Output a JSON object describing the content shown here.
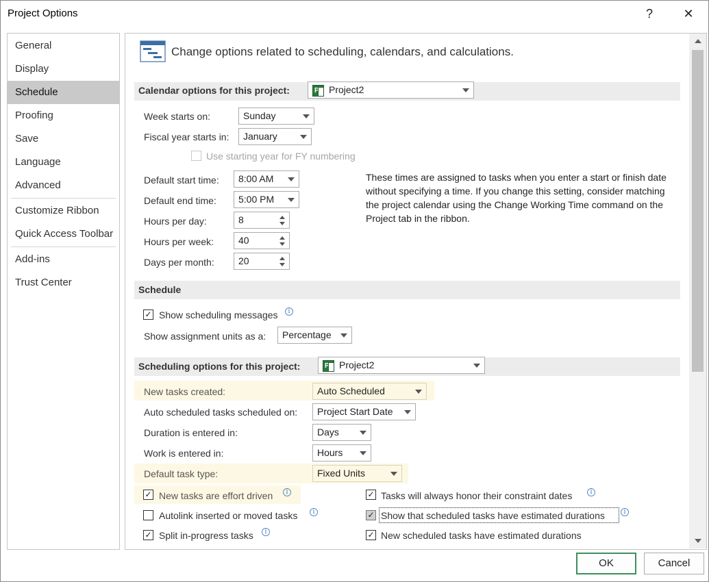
{
  "window": {
    "title": "Project Options",
    "help": "?",
    "close": "✕"
  },
  "sidebar": {
    "items": [
      {
        "label": "General"
      },
      {
        "label": "Display"
      },
      {
        "label": "Schedule"
      },
      {
        "label": "Proofing"
      },
      {
        "label": "Save"
      },
      {
        "label": "Language"
      },
      {
        "label": "Advanced"
      },
      {
        "label": "Customize Ribbon"
      },
      {
        "label": "Quick Access Toolbar"
      },
      {
        "label": "Add-ins"
      },
      {
        "label": "Trust Center"
      }
    ],
    "selected": "Schedule"
  },
  "header": {
    "text": "Change options related to scheduling, calendars, and calculations."
  },
  "calendar": {
    "section_title": "Calendar options for this project:",
    "project_value": "Project2",
    "week_starts_label": "Week starts on:",
    "week_starts_value": "Sunday",
    "fiscal_label": "Fiscal year starts in:",
    "fiscal_value": "January",
    "fy_numbering_label": "Use starting year for FY numbering",
    "start_time_label": "Default start time:",
    "start_time_value": "8:00 AM",
    "end_time_label": "Default end time:",
    "end_time_value": "5:00 PM",
    "hours_day_label": "Hours per day:",
    "hours_day_value": "8",
    "hours_week_label": "Hours per week:",
    "hours_week_value": "40",
    "days_month_label": "Days per month:",
    "days_month_value": "20",
    "description": "These times are assigned to tasks when you enter a start or finish date without specifying a time. If you change this setting, consider matching the project calendar using the Change Working Time command on the Project tab in the ribbon."
  },
  "schedule": {
    "section_title": "Schedule",
    "show_messages_label": "Show scheduling messages",
    "show_messages_checked": true,
    "assignment_units_label": "Show assignment units as a:",
    "assignment_units_value": "Percentage"
  },
  "scheduling_options": {
    "section_title": "Scheduling options for this project:",
    "project_value": "Project2",
    "new_tasks_label": "New tasks created:",
    "new_tasks_value": "Auto Scheduled",
    "auto_sched_label": "Auto scheduled tasks scheduled on:",
    "auto_sched_value": "Project Start Date",
    "duration_label": "Duration is entered in:",
    "duration_value": "Days",
    "work_label": "Work is entered in:",
    "work_value": "Hours",
    "task_type_label": "Default task type:",
    "task_type_value": "Fixed Units",
    "effort_driven_label": "New tasks are effort driven",
    "autolink_label": "Autolink inserted or moved tasks",
    "split_label": "Split in-progress tasks",
    "honor_constraint_label": "Tasks will always honor their constraint dates",
    "show_estimated_label": "Show that scheduled tasks have estimated durations",
    "new_estimated_label": "New scheduled tasks have estimated durations"
  },
  "buttons": {
    "ok": "OK",
    "cancel": "Cancel"
  },
  "colors": {
    "highlight": "#fcf8e3",
    "selected_nav": "#c9c9c9",
    "section_bar": "#ececec",
    "ok_border": "#3e8e5a"
  }
}
